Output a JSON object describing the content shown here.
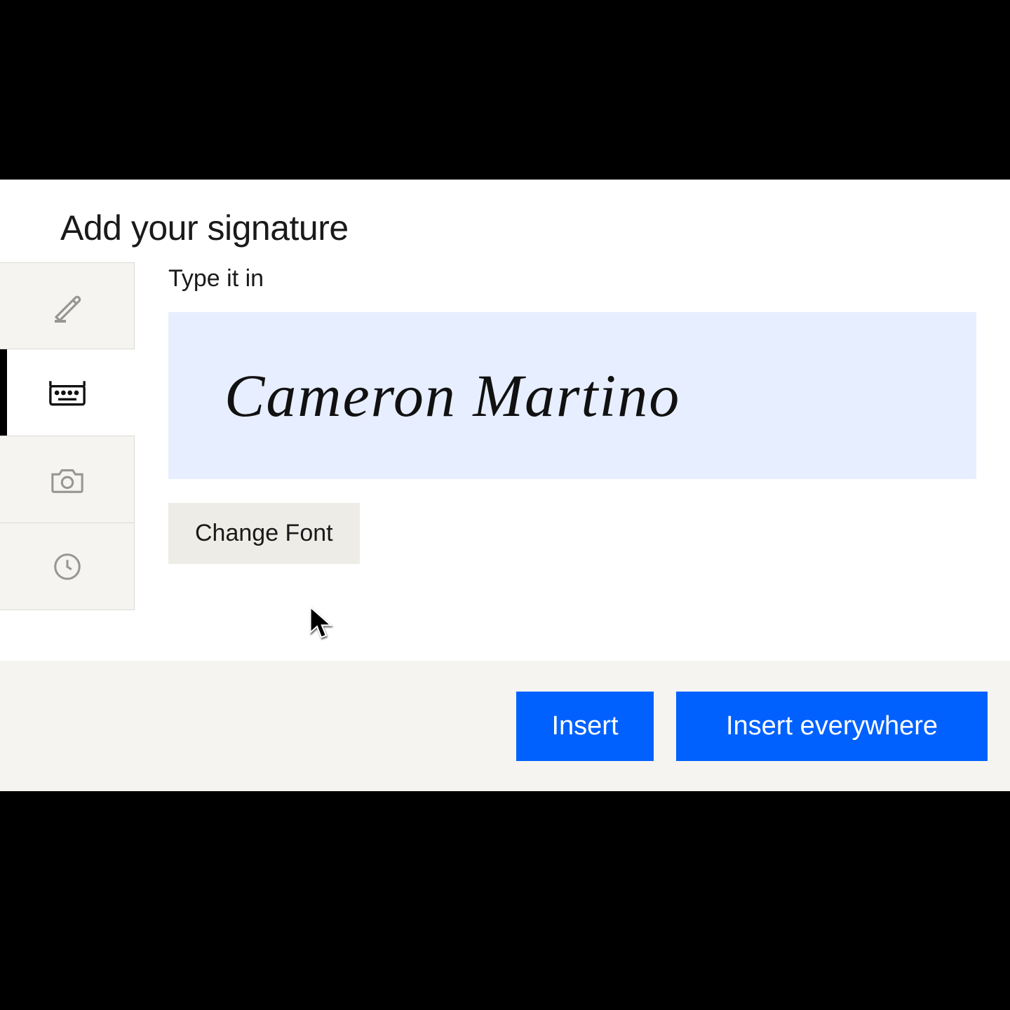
{
  "dialog": {
    "title": "Add your signature",
    "section_label": "Type it in",
    "signature_value": "Cameron Martino",
    "change_font_label": "Change Font"
  },
  "footer": {
    "insert_label": "Insert",
    "insert_everywhere_label": "Insert everywhere"
  },
  "tabs": {
    "draw": "draw-icon",
    "type": "keyboard-icon",
    "camera": "camera-icon",
    "history": "clock-icon",
    "active": "type"
  },
  "colors": {
    "accent": "#0061fe",
    "field_bg": "#e7eeff",
    "panel_bg": "#f5f4f1"
  }
}
